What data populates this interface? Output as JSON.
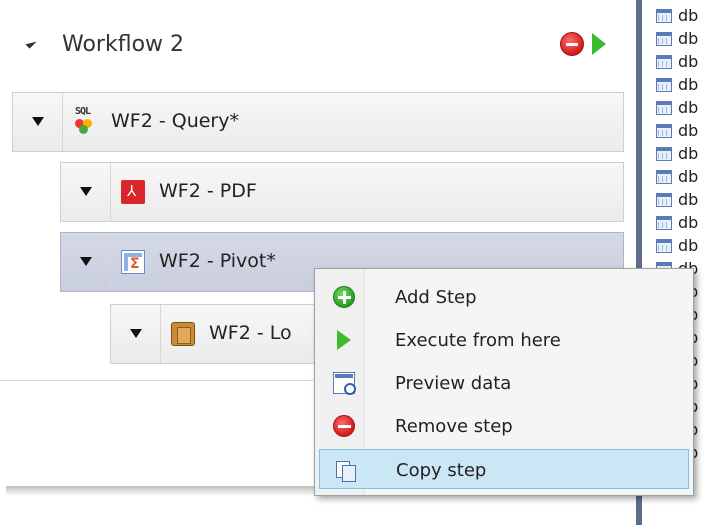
{
  "workflow": {
    "title": "Workflow 2"
  },
  "steps": [
    {
      "label": "WF2 - Query*"
    },
    {
      "label": "WF2 - PDF"
    },
    {
      "label": "WF2 - Pivot*"
    },
    {
      "label": "WF2 - Lo"
    }
  ],
  "db_list": {
    "item_label": "db",
    "count": 20
  },
  "context_menu": {
    "items": [
      {
        "label": "Add Step"
      },
      {
        "label": "Execute from here"
      },
      {
        "label": "Preview data"
      },
      {
        "label": "Remove step"
      },
      {
        "label": "Copy step"
      }
    ],
    "highlighted": "Copy step"
  },
  "icons": {
    "header_remove": "remove-icon",
    "header_run": "run-icon",
    "step_query": "sql-query-icon",
    "step_pdf": "pdf-icon",
    "step_pivot": "pivot-icon",
    "step_load": "load-icon",
    "db_table": "table-icon"
  },
  "colors": {
    "selected_step": "#c9cede",
    "menu_highlight": "#cbe7f6",
    "run_green": "#3dbb2e",
    "remove_red": "#d21a1a"
  }
}
